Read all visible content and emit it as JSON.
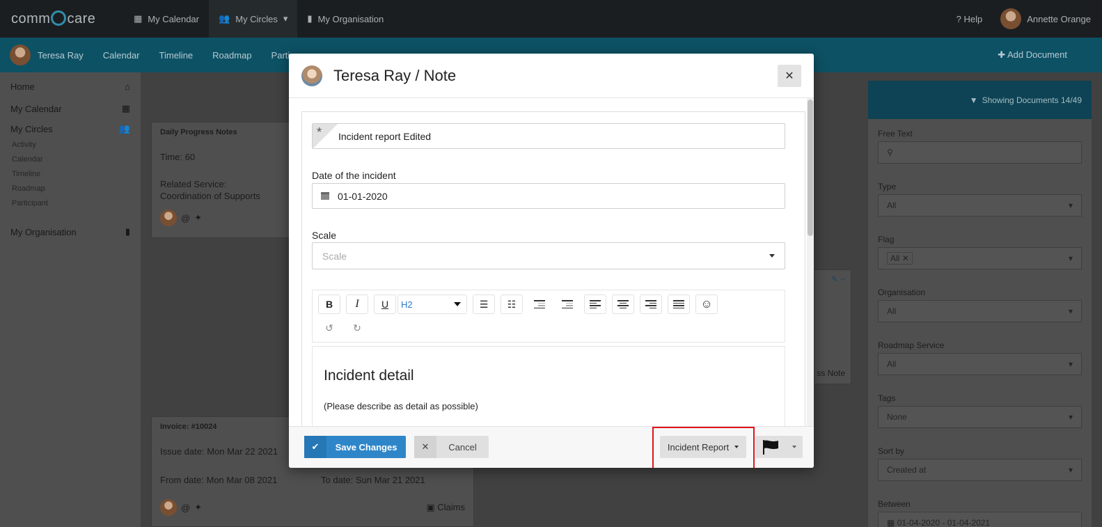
{
  "app": {
    "logo_left": "comm",
    "logo_right": "care",
    "topnav": [
      {
        "label": "My Calendar",
        "icon": "calendar-icon"
      },
      {
        "label": "My Circles",
        "icon": "users-icon"
      },
      {
        "label": "My Organisation",
        "icon": "building-icon"
      }
    ],
    "help": "Help",
    "user_name": "Annette Orange"
  },
  "subbar": {
    "person": "Teresa Ray",
    "tabs": [
      "Calendar",
      "Timeline",
      "Roadmap",
      "Partic"
    ],
    "add_document": "Add Document"
  },
  "sidebar": {
    "home": "Home",
    "my_calendar": "My Calendar",
    "my_circles": "My Circles",
    "circle_items": [
      "Activity",
      "Calendar",
      "Timeline",
      "Roadmap",
      "Participant"
    ],
    "my_organisation": "My Organisation"
  },
  "bg_cards": {
    "progress": {
      "title": "Daily Progress Notes",
      "time_label": "Time:",
      "time_value": "60",
      "related_label": "Related Service:",
      "related_value": "Coordination of Supports",
      "at": "@"
    },
    "invoice": {
      "title": "Invoice: #10024",
      "issue_label": "Issue date:",
      "issue_value": "Mon Mar 22 2021",
      "from_label": "From date:",
      "from_value": "Mon Mar 08 2021",
      "to_label": "To date:",
      "to_value": "Sun Mar 21 2021",
      "at": "@",
      "claims": "Claims"
    },
    "partial_note": "ss Note"
  },
  "filters": {
    "showing": "Showing Documents 14/49",
    "free_text": "Free Text",
    "type_label": "Type",
    "type_value": "All",
    "flag_label": "Flag",
    "flag_value": "All",
    "org_label": "Organisation",
    "org_value": "All",
    "roadmap_label": "Roadmap Service",
    "roadmap_value": "All",
    "tags_label": "Tags",
    "tags_value": "None",
    "sort_label": "Sort by",
    "sort_value": "Created at",
    "between_label": "Between",
    "between_value": "01-04-2020 - 01-04-2021"
  },
  "modal": {
    "title": "Teresa Ray / Note",
    "required_mark": "*",
    "note_title_value": "Incident report Edited",
    "date_label": "Date of the incident",
    "date_value": "01-01-2020",
    "scale_label": "Scale",
    "scale_placeholder": "Scale",
    "toolbar": {
      "bold": "B",
      "italic": "I",
      "underline": "U",
      "heading_value": "H2"
    },
    "editor_heading": "Incident detail",
    "editor_paragraph": "(Please describe as detail as possible)",
    "save_label": "Save Changes",
    "cancel_label": "Cancel",
    "doc_type_label": "Incident Report"
  },
  "colors": {
    "primary": "#2e86c9",
    "highlight": "#e0141a",
    "editor_heading_select": "#2a7cc9"
  }
}
